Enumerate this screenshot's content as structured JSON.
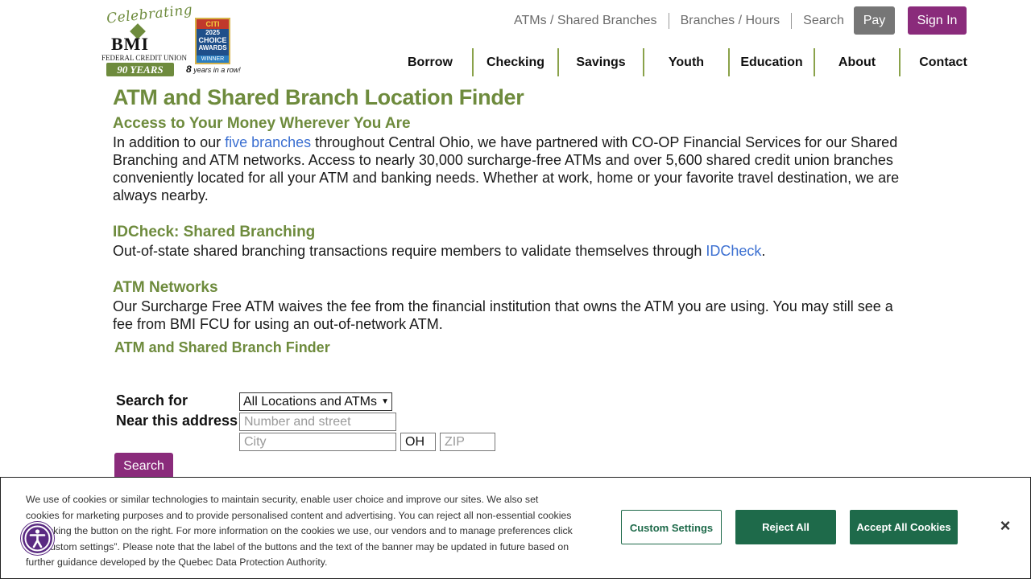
{
  "logo": {
    "celebrating": "Celebrating",
    "bmi": "BMI",
    "fcu": "FEDERAL CREDIT UNION",
    "years": "90 YEARS"
  },
  "award": {
    "top": "CITI",
    "year": "2025",
    "choice": "CHOICE",
    "awards": "AWARDS",
    "winner": "WINNER",
    "tag_num": "8",
    "tag_text": "years in a row!"
  },
  "utility_nav": [
    "ATMs / Shared Branches",
    "Branches / Hours",
    "Search"
  ],
  "buttons": {
    "pay": "Pay",
    "signin": "Sign In"
  },
  "main_nav": [
    "Borrow",
    "Checking",
    "Savings",
    "Youth",
    "Education",
    "About",
    "Contact"
  ],
  "page": {
    "title": "ATM and Shared Branch Location Finder",
    "section1": {
      "heading": "Access to Your Money Wherever You Are",
      "before_link": "In addition to our ",
      "link": "five branches",
      "after_link": " throughout Central Ohio, we have partnered with CO-OP Financial Services for our Shared Branching and ATM networks. Access to nearly 30,000 surcharge-free ATMs and over 5,600 shared credit union branches conveniently located for all your ATM and banking needs.  Whether at work, home or your favorite travel destination, we are always nearby."
    },
    "section2": {
      "heading": "IDCheck: Shared Branching",
      "before_link": "Out-of-state shared branching transactions require members to validate themselves through ",
      "link": "IDCheck",
      "after_link": "."
    },
    "section3": {
      "heading": "ATM Networks",
      "text": "Our Surcharge Free ATM waives the fee from the financial institution that owns the ATM you are using. You may still see a fee from BMI FCU for using an out-of-network ATM."
    }
  },
  "finder": {
    "title": "ATM and Shared Branch Finder",
    "search_for_label": "Search for",
    "near_label": "Near this address",
    "select_value": "All Locations and ATMs",
    "street_placeholder": "Number and street",
    "city_placeholder": "City",
    "state_value": "OH",
    "zip_placeholder": "ZIP",
    "search_button": "Search"
  },
  "cookie": {
    "text": "We use of cookies or similar technologies to maintain security, enable user choice and improve our sites. We also set cookies for marketing purposes and to provide personalised content and advertising. You can reject all non-essential cookies by clicking the button on the right. For more information on the cookies we use, our vendors and to manage preferences click on “Custom settings”. Please note that the label of the buttons and the text of the banner may be updated in future based on further guidance developed by the Quebec Data Protection Authority.",
    "custom": "Custom Settings",
    "reject": "Reject All",
    "accept": "Accept All Cookies",
    "close": "×"
  },
  "colors": {
    "brand_green": "#6e8b3d",
    "brand_purple": "#8a2b7b",
    "link_blue": "#3b6fd1",
    "cookie_green": "#1e6a4a"
  }
}
